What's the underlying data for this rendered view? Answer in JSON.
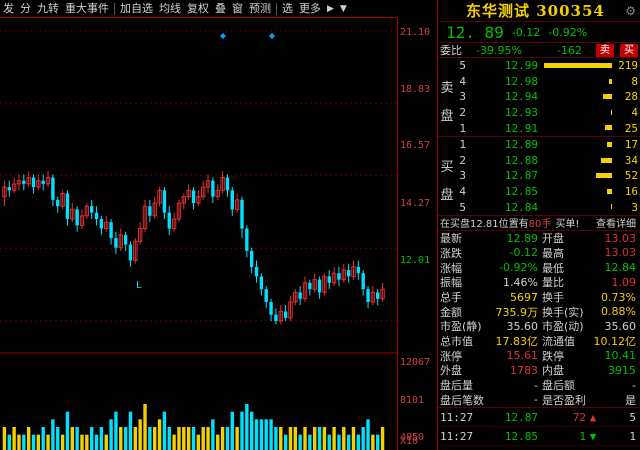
{
  "toolbar": {
    "items": [
      "发",
      "分",
      "九转",
      "重大事件",
      "加自选",
      "均线",
      "复权",
      "叠",
      "窗",
      "预测",
      "选",
      "更多"
    ],
    "more_arrow": "▶",
    "down_arrow": "▼"
  },
  "axis": {
    "price_ticks": [
      "21.10",
      "18.83",
      "16.57",
      "14.27",
      "12.01"
    ],
    "volume_ticks": [
      "12067",
      "8101",
      "4050"
    ],
    "volume_unit": "X10"
  },
  "chart_marker": "L",
  "colors": {
    "up": "#e03030",
    "down": "#00e0ff",
    "volume_up": "#00e0ff",
    "volume_down": "#f5d000",
    "frame": "#a00000"
  },
  "chart_data": {
    "type": "candlestick",
    "ylim": [
      11.0,
      21.5
    ],
    "candles": [
      [
        15.9,
        16.2,
        15.6,
        16.4
      ],
      [
        16.2,
        16.1,
        15.9,
        16.4
      ],
      [
        16.1,
        16.3,
        16.0,
        16.5
      ],
      [
        16.3,
        16.4,
        16.1,
        16.6
      ],
      [
        16.4,
        16.3,
        16.1,
        16.6
      ],
      [
        16.3,
        16.5,
        16.2,
        16.7
      ],
      [
        16.5,
        16.2,
        16.0,
        16.6
      ],
      [
        16.2,
        16.4,
        16.1,
        16.6
      ],
      [
        16.4,
        16.3,
        16.1,
        16.6
      ],
      [
        16.3,
        16.5,
        16.2,
        16.7
      ],
      [
        16.5,
        15.8,
        15.6,
        16.6
      ],
      [
        15.8,
        15.6,
        15.4,
        15.9
      ],
      [
        15.6,
        16.0,
        15.5,
        16.1
      ],
      [
        16.0,
        15.2,
        15.0,
        16.1
      ],
      [
        15.2,
        15.5,
        15.1,
        15.7
      ],
      [
        15.5,
        15.0,
        14.8,
        15.6
      ],
      [
        15.0,
        15.3,
        14.9,
        15.5
      ],
      [
        15.3,
        15.6,
        15.2,
        15.7
      ],
      [
        15.6,
        15.4,
        15.2,
        15.8
      ],
      [
        15.4,
        15.2,
        15.0,
        15.6
      ],
      [
        15.2,
        14.9,
        14.7,
        15.3
      ],
      [
        14.9,
        15.1,
        14.8,
        15.3
      ],
      [
        15.1,
        14.6,
        14.4,
        15.2
      ],
      [
        14.6,
        14.3,
        14.1,
        14.8
      ],
      [
        14.3,
        14.7,
        14.2,
        14.9
      ],
      [
        14.7,
        14.4,
        14.2,
        14.8
      ],
      [
        14.4,
        13.9,
        13.7,
        14.5
      ],
      [
        13.9,
        14.5,
        13.8,
        14.6
      ],
      [
        14.5,
        14.9,
        14.4,
        15.1
      ],
      [
        14.9,
        15.6,
        14.8,
        15.8
      ],
      [
        15.6,
        15.3,
        15.1,
        15.8
      ],
      [
        15.3,
        15.7,
        15.2,
        15.9
      ],
      [
        15.7,
        16.1,
        15.6,
        16.2
      ],
      [
        16.1,
        15.4,
        15.2,
        16.2
      ],
      [
        15.4,
        14.9,
        14.7,
        15.6
      ],
      [
        14.9,
        15.2,
        14.8,
        15.4
      ],
      [
        15.2,
        15.7,
        15.1,
        15.8
      ],
      [
        15.7,
        15.9,
        15.5,
        16.0
      ],
      [
        15.9,
        16.1,
        15.8,
        16.3
      ],
      [
        16.1,
        15.7,
        15.5,
        16.2
      ],
      [
        15.7,
        15.9,
        15.6,
        16.1
      ],
      [
        15.9,
        16.2,
        15.8,
        16.4
      ],
      [
        16.2,
        16.4,
        16.0,
        16.6
      ],
      [
        16.4,
        15.9,
        15.7,
        16.5
      ],
      [
        15.9,
        16.1,
        15.8,
        16.3
      ],
      [
        16.1,
        16.5,
        16.0,
        16.7
      ],
      [
        16.5,
        16.1,
        15.9,
        16.6
      ],
      [
        16.1,
        15.5,
        15.3,
        16.2
      ],
      [
        15.5,
        15.8,
        15.4,
        16.0
      ],
      [
        15.8,
        14.9,
        14.6,
        15.9
      ],
      [
        14.9,
        14.2,
        14.0,
        15.0
      ],
      [
        14.2,
        13.7,
        13.5,
        14.3
      ],
      [
        13.7,
        13.4,
        13.2,
        13.9
      ],
      [
        13.4,
        13.0,
        12.8,
        13.5
      ],
      [
        13.0,
        12.6,
        12.4,
        13.1
      ],
      [
        12.6,
        12.2,
        12.0,
        12.7
      ],
      [
        12.2,
        12.0,
        11.9,
        12.4
      ],
      [
        12.0,
        12.3,
        11.9,
        12.5
      ],
      [
        12.3,
        12.1,
        12.0,
        12.5
      ],
      [
        12.1,
        12.6,
        12.0,
        12.8
      ],
      [
        12.6,
        12.9,
        12.5,
        13.0
      ],
      [
        12.9,
        12.7,
        12.5,
        13.1
      ],
      [
        12.7,
        13.2,
        12.6,
        13.4
      ],
      [
        13.2,
        13.0,
        12.8,
        13.3
      ],
      [
        13.0,
        13.3,
        12.9,
        13.5
      ],
      [
        13.3,
        12.9,
        12.7,
        13.4
      ],
      [
        12.9,
        13.4,
        12.8,
        13.5
      ],
      [
        13.4,
        13.2,
        13.0,
        13.6
      ],
      [
        13.2,
        13.5,
        13.1,
        13.7
      ],
      [
        13.5,
        13.3,
        13.1,
        13.7
      ],
      [
        13.3,
        13.6,
        13.2,
        13.8
      ],
      [
        13.6,
        13.4,
        13.2,
        13.8
      ],
      [
        13.4,
        13.7,
        13.3,
        13.9
      ],
      [
        13.7,
        13.5,
        13.3,
        13.9
      ],
      [
        13.5,
        13.0,
        12.8,
        13.6
      ],
      [
        13.0,
        12.6,
        12.4,
        13.1
      ],
      [
        12.6,
        12.9,
        12.5,
        13.1
      ],
      [
        12.9,
        12.7,
        12.5,
        13.0
      ],
      [
        12.7,
        13.0,
        12.6,
        13.2
      ]
    ],
    "volumes": [
      3,
      2,
      3,
      2,
      2,
      3,
      2,
      2,
      3,
      2,
      4,
      3,
      2,
      5,
      3,
      3,
      2,
      2,
      3,
      2,
      3,
      2,
      4,
      5,
      3,
      3,
      5,
      3,
      4,
      6,
      3,
      3,
      4,
      5,
      3,
      2,
      3,
      3,
      3,
      3,
      2,
      3,
      3,
      4,
      2,
      3,
      3,
      5,
      3,
      5,
      6,
      5,
      4,
      4,
      4,
      4,
      3,
      3,
      2,
      3,
      3,
      2,
      3,
      2,
      3,
      3,
      3,
      2,
      3,
      2,
      3,
      2,
      3,
      2,
      3,
      4,
      2,
      2,
      3
    ],
    "volume_max": 12
  },
  "stock": {
    "name": "东华测试 300354",
    "price": "12. 89",
    "change": "-0.12",
    "change_pct": "-0.92%",
    "settings_icon": "⚙"
  },
  "weibi": {
    "label": "委比",
    "pct": "-39.95%",
    "diff": "-162",
    "sell_btn": "卖",
    "buy_btn": "买"
  },
  "sell_book": {
    "label_top": "卖",
    "label_bottom": "盘",
    "rows": [
      {
        "lv": "5",
        "price": "12.99",
        "vol": "219",
        "bar": 1.0
      },
      {
        "lv": "4",
        "price": "12.98",
        "vol": "8",
        "bar": 0.04
      },
      {
        "lv": "3",
        "price": "12.94",
        "vol": "28",
        "bar": 0.13
      },
      {
        "lv": "2",
        "price": "12.93",
        "vol": "4",
        "bar": 0.02
      },
      {
        "lv": "1",
        "price": "12.91",
        "vol": "25",
        "bar": 0.11
      }
    ]
  },
  "buy_book": {
    "label_top": "买",
    "label_bottom": "盘",
    "rows": [
      {
        "lv": "1",
        "price": "12.89",
        "vol": "17",
        "bar": 0.08
      },
      {
        "lv": "2",
        "price": "12.88",
        "vol": "34",
        "bar": 0.16
      },
      {
        "lv": "3",
        "price": "12.87",
        "vol": "52",
        "bar": 0.24
      },
      {
        "lv": "4",
        "price": "12.85",
        "vol": "16",
        "bar": 0.07
      },
      {
        "lv": "5",
        "price": "12.84",
        "vol": "3",
        "bar": 0.01
      }
    ]
  },
  "buy_info": {
    "t1": "在买盘12.81位置有",
    "t2": "80手",
    "t3": "买单!",
    "t4": "查看详细"
  },
  "stats": [
    {
      "l1": "最新",
      "v1": "12.89",
      "c1": "green",
      "l2": "开盘",
      "v2": "13.03",
      "c2": "red"
    },
    {
      "l1": "涨跌",
      "v1": "-0.12",
      "c1": "green",
      "l2": "最高",
      "v2": "13.03",
      "c2": "red"
    },
    {
      "l1": "涨幅",
      "v1": "-0.92%",
      "c1": "green",
      "l2": "最低",
      "v2": "12.84",
      "c2": "green"
    },
    {
      "l1": "振幅",
      "v1": "1.46%",
      "c1": "white",
      "l2": "量比",
      "v2": "1.09",
      "c2": "red"
    },
    {
      "l1": "总手",
      "v1": "5697",
      "c1": "yellow",
      "l2": "换手",
      "v2": "0.73%",
      "c2": "yellow"
    },
    {
      "l1": "金额",
      "v1": "735.9万",
      "c1": "yellow",
      "l2": "换手(实)",
      "v2": "0.88%",
      "c2": "yellow"
    },
    {
      "l1": "市盈(静)",
      "v1": "35.60",
      "c1": "white",
      "l2": "市盈(动)",
      "v2": "35.60",
      "c2": "white"
    },
    {
      "l1": "总市值",
      "v1": "17.83亿",
      "c1": "yellow",
      "l2": "流通值",
      "v2": "10.12亿",
      "c2": "yellow"
    },
    {
      "l1": "涨停",
      "v1": "15.61",
      "c1": "red",
      "l2": "跌停",
      "v2": "10.41",
      "c2": "green"
    },
    {
      "l1": "外盘",
      "v1": "1783",
      "c1": "red",
      "l2": "内盘",
      "v2": "3915",
      "c2": "green"
    },
    {
      "l1": "盘后量",
      "v1": "-",
      "c1": "white",
      "l2": "盘后额",
      "v2": "-",
      "c2": "white"
    },
    {
      "l1": "盘后笔数",
      "v1": "-",
      "c1": "white",
      "l2": "是否盈利",
      "v2": "是",
      "c2": "white"
    }
  ],
  "ticks": [
    {
      "time": "11:27",
      "price": "12.87",
      "vol": "72",
      "arrow": "▲",
      "arrow_color": "red",
      "n": "5",
      "vol_color": "red"
    },
    {
      "time": "11:27",
      "price": "12.85",
      "vol": "1",
      "arrow": "▼",
      "arrow_color": "green",
      "n": "1",
      "vol_color": "green"
    }
  ]
}
